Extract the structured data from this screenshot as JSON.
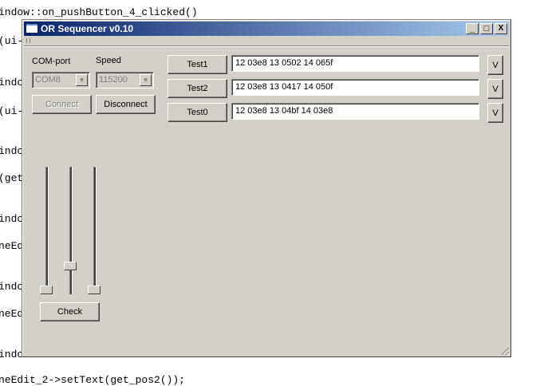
{
  "background_code": [
    "indow::on_pushButton_4_clicked()",
    "(ui-",
    "indc",
    "(ui-",
    "indc",
    "(get",
    "indc",
    "neEd",
    "indc",
    "neEd",
    "indc",
    "neEdit_2->setText(get_pos2());"
  ],
  "window": {
    "title": "OR Sequencer v0.10",
    "minimize": "_",
    "maximize": "□",
    "close": "X"
  },
  "serial": {
    "com_label": "COM-port",
    "com_value": "COM8",
    "speed_label": "Speed",
    "speed_value": "115200",
    "connect": "Connect",
    "disconnect": "Disconnect"
  },
  "tests": [
    {
      "button": "Test1",
      "value": "12 03e8 13 0502 14 065f",
      "v": "V"
    },
    {
      "button": "Test2",
      "value": "12 03e8 13 0417 14 050f",
      "v": "V"
    },
    {
      "button": "Test0",
      "value": "12 03e8 13 04bf 14 03e8",
      "v": "V"
    }
  ],
  "sliders": [
    {
      "value_fraction": 0.0
    },
    {
      "value_fraction": 0.2
    },
    {
      "value_fraction": 0.0
    }
  ],
  "check": "Check"
}
